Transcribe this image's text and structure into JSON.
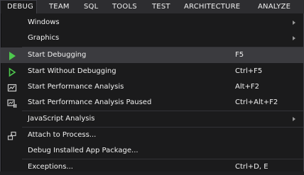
{
  "menubar": {
    "items": [
      {
        "label": "DEBUG"
      },
      {
        "label": "TEAM"
      },
      {
        "label": "SQL"
      },
      {
        "label": "TOOLS"
      },
      {
        "label": "TEST"
      },
      {
        "label": "ARCHITECTURE"
      },
      {
        "label": "ANALYZE"
      }
    ]
  },
  "debug_menu": {
    "items": [
      {
        "label": "Windows",
        "shortcut": "",
        "icon": "",
        "submenu": true
      },
      {
        "label": "Graphics",
        "shortcut": "",
        "icon": "",
        "submenu": true
      },
      {
        "label": "Start Debugging",
        "shortcut": "F5",
        "icon": "play-icon",
        "submenu": false
      },
      {
        "label": "Start Without Debugging",
        "shortcut": "Ctrl+F5",
        "icon": "play-outline-icon",
        "submenu": false
      },
      {
        "label": "Start Performance Analysis",
        "shortcut": "Alt+F2",
        "icon": "performance-icon",
        "submenu": false
      },
      {
        "label": "Start Performance Analysis Paused",
        "shortcut": "Ctrl+Alt+F2",
        "icon": "performance-paused-icon",
        "submenu": false
      },
      {
        "label": "JavaScript Analysis",
        "shortcut": "",
        "icon": "",
        "submenu": true
      },
      {
        "label": "Attach to Process...",
        "shortcut": "",
        "icon": "attach-process-icon",
        "submenu": false
      },
      {
        "label": "Debug Installed App Package...",
        "shortcut": "",
        "icon": "",
        "submenu": false
      },
      {
        "label": "Exceptions...",
        "shortcut": "Ctrl+D, E",
        "icon": "",
        "submenu": false
      }
    ]
  },
  "colors": {
    "play_green": "#4ec94e",
    "text": "#f1f1f1",
    "menu_background": "#1b1b1c",
    "hover_background": "#3b3b3f"
  }
}
